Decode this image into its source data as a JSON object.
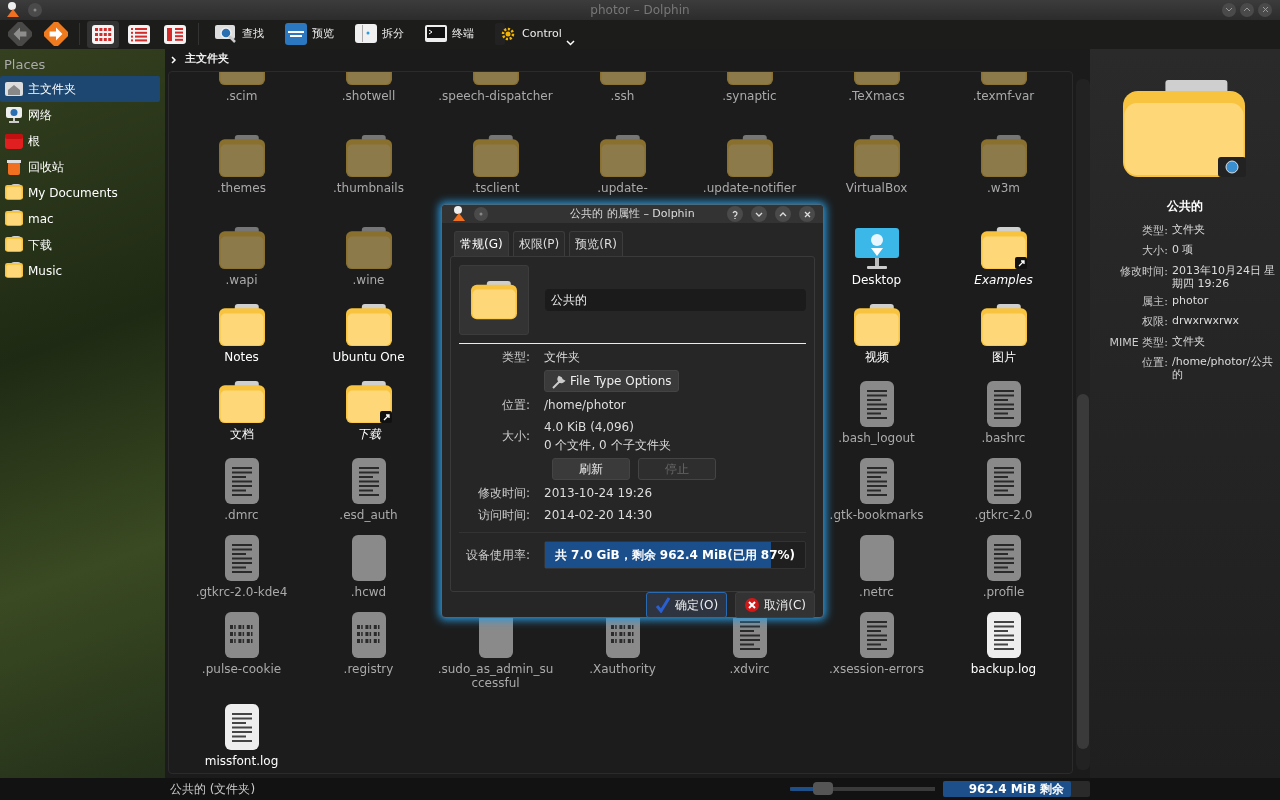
{
  "window": {
    "title": "photor – Dolphin"
  },
  "toolbar": {
    "navigation": [
      {
        "kind": "back",
        "disabled": true
      },
      {
        "kind": "forward",
        "disabled": false
      }
    ],
    "view_modes": [
      {
        "kind": "icons",
        "selected": true
      },
      {
        "kind": "details",
        "selected": false
      },
      {
        "kind": "columns",
        "selected": false
      }
    ],
    "actions": [
      {
        "kind": "find",
        "label": "查找"
      },
      {
        "kind": "preview",
        "label": "预览"
      },
      {
        "kind": "split",
        "label": "拆分"
      },
      {
        "kind": "terminal",
        "label": "终端"
      },
      {
        "kind": "control",
        "label": "Control"
      }
    ]
  },
  "places": {
    "title": "Places",
    "items": [
      {
        "label": "主文件夹",
        "kind": "home",
        "selected": true
      },
      {
        "label": "网络",
        "kind": "network",
        "selected": false
      },
      {
        "label": "根",
        "kind": "root",
        "selected": false
      },
      {
        "label": "回收站",
        "kind": "trash",
        "selected": false
      },
      {
        "label": "My Documents",
        "kind": "folder",
        "selected": false
      },
      {
        "label": "mac",
        "kind": "folder",
        "selected": false
      },
      {
        "label": "下载",
        "kind": "folder",
        "selected": false
      },
      {
        "label": "Music",
        "kind": "folder",
        "selected": false
      }
    ]
  },
  "breadcrumb": [
    "主文件夹"
  ],
  "files": [
    {
      "items": [
        {
          "name": ".scim",
          "kind": "folder",
          "dimmed": true,
          "link": false
        },
        {
          "name": ".shotwell",
          "kind": "folder",
          "dimmed": true,
          "link": false
        },
        {
          "name": ".speech-dispatcher",
          "kind": "folder",
          "dimmed": true,
          "link": false
        },
        {
          "name": ".ssh",
          "kind": "folder",
          "dimmed": true,
          "link": false
        },
        {
          "name": ".synaptic",
          "kind": "folder",
          "dimmed": true,
          "link": false
        },
        {
          "name": ".TeXmacs",
          "kind": "folder",
          "dimmed": true,
          "link": false
        },
        {
          "name": ".texmf-var",
          "kind": "folder",
          "dimmed": true,
          "link": false
        }
      ]
    },
    {
      "items": [
        {
          "name": ".themes",
          "kind": "folder",
          "dimmed": true,
          "link": false
        },
        {
          "name": ".thumbnails",
          "kind": "folder",
          "dimmed": true,
          "link": false
        },
        {
          "name": ".tsclient",
          "kind": "folder",
          "dimmed": true,
          "link": false
        },
        {
          "name": ".update-",
          "kind": "folder",
          "dimmed": true,
          "link": false
        },
        {
          "name": ".update-notifier",
          "kind": "folder",
          "dimmed": true,
          "link": false
        },
        {
          "name": "VirtualBox",
          "kind": "folder",
          "dimmed": true,
          "link": false
        },
        {
          "name": ".w3m",
          "kind": "folder",
          "dimmed": true,
          "link": false
        }
      ]
    },
    {
      "left": [
        {
          "name": ".wapi",
          "kind": "folder",
          "dimmed": true,
          "link": false
        },
        {
          "name": ".wine",
          "kind": "folder",
          "dimmed": true,
          "link": false
        }
      ],
      "right": [
        {
          "name": "Desktop",
          "kind": "desktop",
          "dimmed": false,
          "link": false
        },
        {
          "name": "Examples",
          "kind": "folder",
          "dimmed": false,
          "link": true
        }
      ]
    },
    {
      "left": [
        {
          "name": "Notes",
          "kind": "folder",
          "dimmed": false,
          "link": false
        },
        {
          "name": "Ubuntu One",
          "kind": "folder",
          "dimmed": false,
          "link": false
        }
      ],
      "right": [
        {
          "name": "视频",
          "kind": "folder",
          "dimmed": false,
          "link": false
        },
        {
          "name": "图片",
          "kind": "folder",
          "dimmed": false,
          "link": false
        }
      ]
    },
    {
      "left": [
        {
          "name": "文档",
          "kind": "folder",
          "dimmed": false,
          "link": false
        },
        {
          "name": "下载",
          "kind": "folder",
          "dimmed": false,
          "link": true
        }
      ],
      "right": [
        {
          "name": ".bash_logout",
          "kind": "text",
          "dimmed": true,
          "link": false
        },
        {
          "name": ".bashrc",
          "kind": "text",
          "dimmed": true,
          "link": false
        }
      ]
    },
    {
      "left": [
        {
          "name": ".dmrc",
          "kind": "text",
          "dimmed": true,
          "link": false
        },
        {
          "name": ".esd_auth",
          "kind": "text",
          "dimmed": true,
          "link": false
        }
      ],
      "right": [
        {
          "name": ".gtk-bookmarks",
          "kind": "text",
          "dimmed": true,
          "link": false
        },
        {
          "name": ".gtkrc-2.0",
          "kind": "text",
          "dimmed": true,
          "link": false
        }
      ]
    },
    {
      "left": [
        {
          "name": ".gtkrc-2.0-kde4",
          "kind": "text",
          "dimmed": true,
          "link": false
        },
        {
          "name": ".hcwd",
          "kind": "blank",
          "dimmed": true,
          "link": false
        }
      ],
      "right": [
        {
          "name": ".netrc",
          "kind": "blank",
          "dimmed": true,
          "link": false
        },
        {
          "name": ".profile",
          "kind": "text",
          "dimmed": true,
          "link": false
        }
      ]
    },
    {
      "items": [
        {
          "name": ".pulse-cookie",
          "kind": "binary",
          "dimmed": true,
          "link": false
        },
        {
          "name": ".registry",
          "kind": "binary",
          "dimmed": true,
          "link": false
        },
        {
          "name": ".sudo_as_admin_successful",
          "kind": "blank",
          "dimmed": true,
          "link": false
        },
        {
          "name": ".Xauthority",
          "kind": "binary",
          "dimmed": true,
          "link": false
        },
        {
          "name": ".xdvirc",
          "kind": "text",
          "dimmed": true,
          "link": false
        },
        {
          "name": ".xsession-errors",
          "kind": "text",
          "dimmed": true,
          "link": false
        },
        {
          "name": "backup.log",
          "kind": "text",
          "dimmed": false,
          "link": false
        }
      ]
    },
    {
      "items": [
        {
          "name": "missfont.log",
          "kind": "text",
          "dimmed": false,
          "link": false
        }
      ]
    }
  ],
  "info_panel": {
    "name": "公共的",
    "fields": [
      {
        "key": "类型:",
        "value": "文件夹"
      },
      {
        "key": "大小:",
        "value": "0 项"
      },
      {
        "key": "修改时间:",
        "value": "2013年10月24日 星期四 19:26"
      },
      {
        "key": "属主:",
        "value": "photor"
      },
      {
        "key": "权限:",
        "value": "drwxrwxrwx"
      },
      {
        "key": "MIME 类型:",
        "value": "文件夹"
      },
      {
        "key": "位置:",
        "value": "/home/photor/公共的"
      }
    ]
  },
  "status_bar": {
    "text": "公共的 (文件夹)",
    "zoom": {
      "level": 0.23
    },
    "free_space": {
      "text": "962.4 MiB 剩余",
      "level": 0.87
    }
  },
  "dialog": {
    "title": "公共的 的属性 – Dolphin",
    "tabs": [
      {
        "label": "常规(G)",
        "selected": true
      },
      {
        "label": "权限(P)",
        "selected": false
      },
      {
        "label": "预览(R)",
        "selected": false
      }
    ],
    "name_value": "公共的",
    "type_label": "类型:",
    "type_value": "文件夹",
    "file_type_button": "File Type Options",
    "location_label": "位置:",
    "location_value": "/home/photor",
    "size_label": "大小:",
    "size_value": "4.0 KiB (4,096)",
    "size_counts": "0 个文件, 0 个子文件夹",
    "size_buttons": [
      {
        "label": "刷新",
        "disabled": false
      },
      {
        "label": "停止",
        "disabled": true
      }
    ],
    "times": [
      {
        "label": "修改时间:",
        "value": "2013-10-24 19:26"
      },
      {
        "label": "访问时间:",
        "value": "2014-02-20 14:30"
      }
    ],
    "usage": {
      "label": "设备使用率:",
      "text": "共 7.0 GiB，剩余 962.4 MiB(已用 87%)",
      "level": 0.87
    },
    "buttons": [
      {
        "kind": "ok",
        "label": "确定(O)",
        "default": true
      },
      {
        "kind": "cancel",
        "label": "取消(C)",
        "default": false
      }
    ]
  }
}
